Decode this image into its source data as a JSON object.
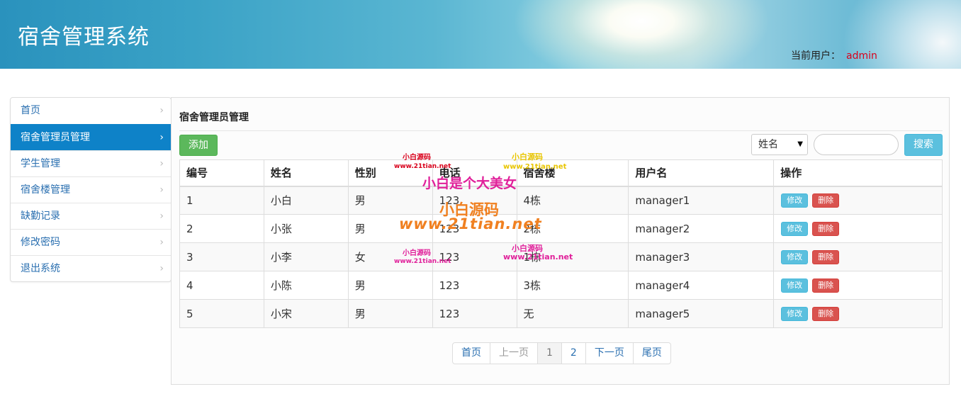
{
  "app": {
    "title": "宿舍管理系统"
  },
  "user": {
    "label": "当前用户：",
    "name": "admin"
  },
  "sidebar": {
    "items": [
      {
        "label": "首页",
        "active": false
      },
      {
        "label": "宿舍管理员管理",
        "active": true
      },
      {
        "label": "学生管理",
        "active": false
      },
      {
        "label": "宿舍楼管理",
        "active": false
      },
      {
        "label": "缺勤记录",
        "active": false
      },
      {
        "label": "修改密码",
        "active": false
      },
      {
        "label": "退出系统",
        "active": false
      }
    ]
  },
  "main": {
    "title": "宿舍管理员管理",
    "add_label": "添加",
    "search": {
      "field_selected": "姓名",
      "query": "",
      "button_label": "搜索"
    },
    "table": {
      "headers": [
        "编号",
        "姓名",
        "性别",
        "电话",
        "宿舍楼",
        "用户名",
        "操作"
      ],
      "rows": [
        [
          "1",
          "小白",
          "男",
          "123",
          "4栋",
          "manager1"
        ],
        [
          "2",
          "小张",
          "男",
          "123",
          "2栋",
          "manager2"
        ],
        [
          "3",
          "小李",
          "女",
          "123",
          "1栋",
          "manager3"
        ],
        [
          "4",
          "小陈",
          "男",
          "123",
          "3栋",
          "manager4"
        ],
        [
          "5",
          "小宋",
          "男",
          "123",
          "无",
          "manager5"
        ]
      ],
      "edit_label": "修改",
      "delete_label": "删除"
    },
    "pagination": {
      "first": "首页",
      "prev": "上一页",
      "pages": [
        "1",
        "2"
      ],
      "current": "1",
      "next": "下一页",
      "last": "尾页"
    }
  },
  "watermark": {
    "small_1_cn": "小白源码",
    "small_1_url": "www.21tian.net",
    "small_2_cn": "小白源码",
    "small_2_url": "www.21tian.net",
    "big_line1": "小白是个大美女",
    "big_line2": "小白源码",
    "big_line3": "www.21tian.net",
    "small_3_cn": "小白源码",
    "small_3_url": "www.21tian.net",
    "small_4_cn": "小白源码",
    "small_4_url": "www.21tian.net"
  }
}
